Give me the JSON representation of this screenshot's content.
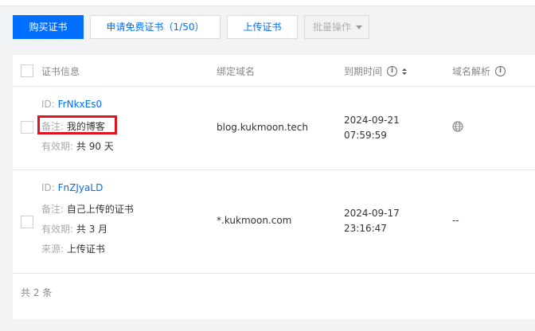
{
  "toolbar": {
    "buy_label": "购买证书",
    "free_label": "申请免费证书（1/50）",
    "upload_label": "上传证书",
    "batch_label": "批量操作"
  },
  "table": {
    "columns": {
      "cert_info": "证书信息",
      "domain": "绑定域名",
      "expire": "到期时间",
      "dns": "域名解析"
    },
    "rows": [
      {
        "id_label": "ID:",
        "id": "FrNkxEs0",
        "remark_label": "备注:",
        "remark": "我的博客",
        "validity_label": "有效期:",
        "validity": "共 90 天",
        "domain": "blog.kukmoon.tech",
        "expire_date": "2024-09-21",
        "expire_time": "07:59:59",
        "dns_icon": "globe-icon"
      },
      {
        "id_label": "ID:",
        "id": "FnZJyaLD",
        "remark_label": "备注:",
        "remark": "自己上传的证书",
        "validity_label": "有效期:",
        "validity": "共 3 月",
        "source_label": "来源:",
        "source": "上传证书",
        "domain": "*.kukmoon.com",
        "expire_date": "2024-09-17",
        "expire_time": "23:16:47",
        "dns": "--"
      }
    ]
  },
  "footer": {
    "total": "共 2 条"
  },
  "colors": {
    "primary": "#006eff",
    "highlight": "#e0141e"
  }
}
